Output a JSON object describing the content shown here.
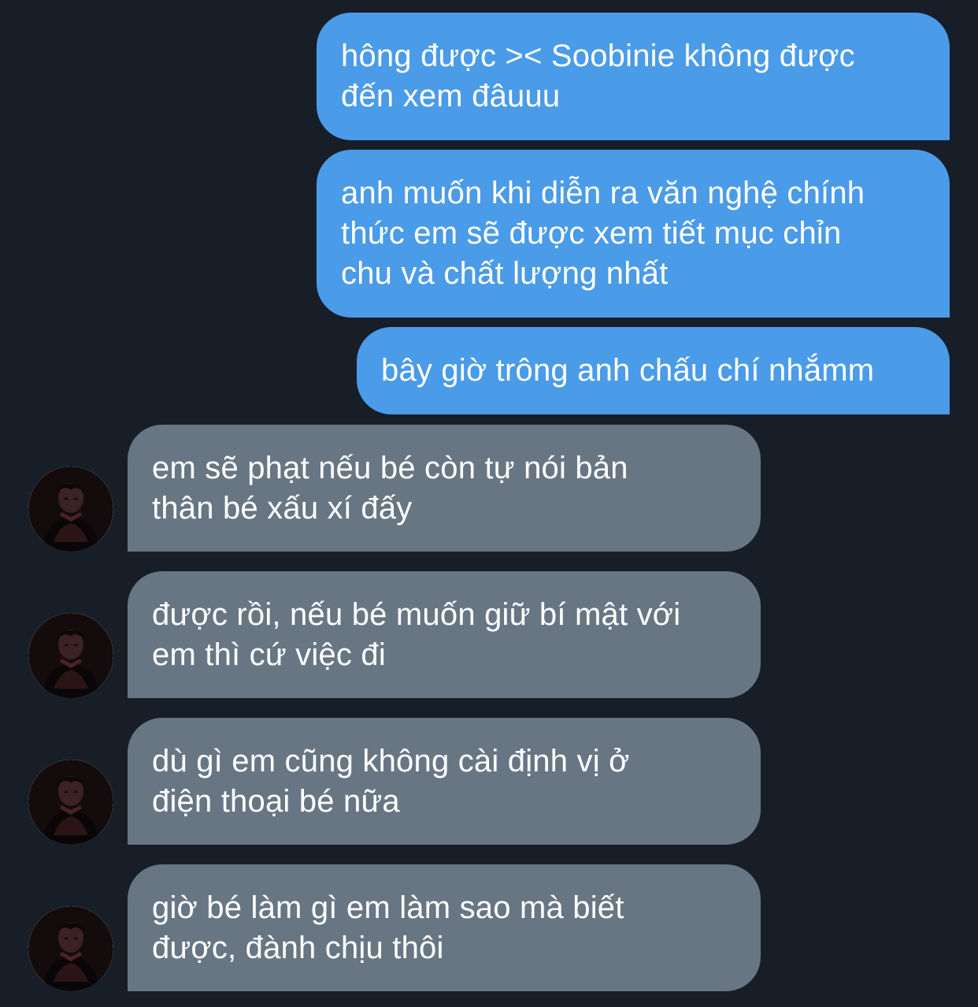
{
  "conversation": {
    "sent_messages": [
      {
        "text": "hông được >< Soobinie không được\nđến xem đâuuu"
      },
      {
        "text": "anh muốn khi diễn ra văn nghệ chính\nthức em sẽ được xem tiết mục chỉn\nchu và chất lượng nhất"
      },
      {
        "text": "bây giờ trông anh chấu chí nhắmm"
      }
    ],
    "received_messages": [
      {
        "text": "em sẽ phạt nếu bé còn tự nói bản\nthân bé xấu xí đấy"
      },
      {
        "text": "được rồi, nếu bé muốn giữ bí mật với\nem thì cứ việc đi"
      },
      {
        "text": "dù gì em cũng không cài định vị ở\nđiện thoại bé nữa"
      },
      {
        "text": "giờ bé làm gì em làm sao mà biết\nđược, đành chịu thôi"
      }
    ]
  },
  "colors": {
    "background": "#171e28",
    "sent_bubble": "#4a9be8",
    "received_bubble": "#687684",
    "text": "#ffffff"
  },
  "icons": {
    "contact_avatar": "profile-photo-avatar"
  }
}
